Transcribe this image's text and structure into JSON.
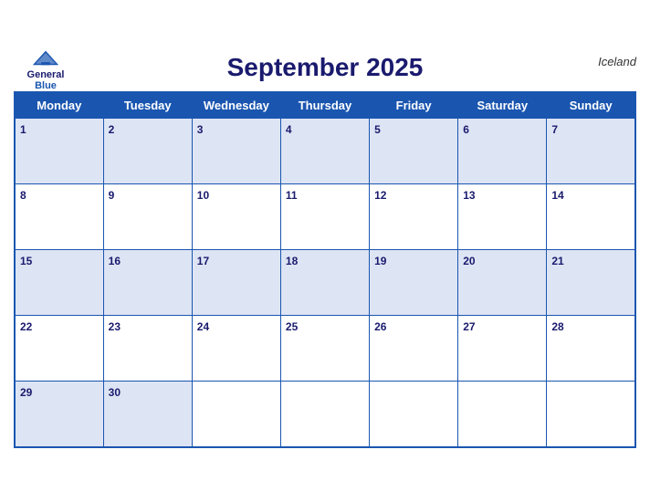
{
  "header": {
    "title": "September 2025",
    "country": "Iceland",
    "logo": {
      "line1": "General",
      "line2": "Blue"
    }
  },
  "weekdays": [
    "Monday",
    "Tuesday",
    "Wednesday",
    "Thursday",
    "Friday",
    "Saturday",
    "Sunday"
  ],
  "weeks": [
    [
      1,
      2,
      3,
      4,
      5,
      6,
      7
    ],
    [
      8,
      9,
      10,
      11,
      12,
      13,
      14
    ],
    [
      15,
      16,
      17,
      18,
      19,
      20,
      21
    ],
    [
      22,
      23,
      24,
      25,
      26,
      27,
      28
    ],
    [
      29,
      30,
      null,
      null,
      null,
      null,
      null
    ]
  ]
}
